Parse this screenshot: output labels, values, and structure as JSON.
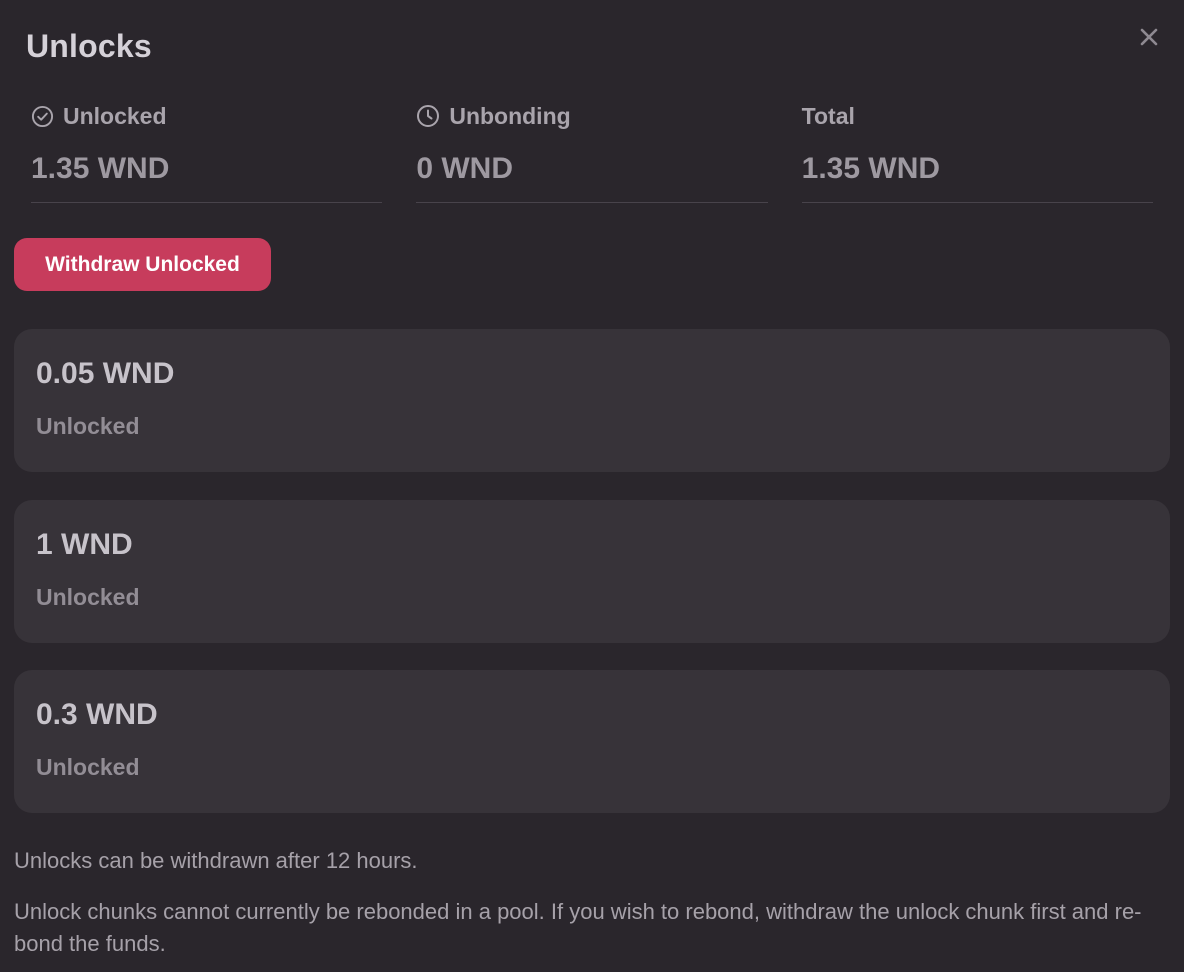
{
  "modal": {
    "title": "Unlocks",
    "close_icon": "close-icon"
  },
  "stats": [
    {
      "label": "Unlocked",
      "value": "1.35 WND",
      "icon": "check-circle-icon"
    },
    {
      "label": "Unbonding",
      "value": "0 WND",
      "icon": "clock-icon"
    },
    {
      "label": "Total",
      "value": "1.35 WND"
    }
  ],
  "actions": {
    "withdraw_label": "Withdraw Unlocked"
  },
  "chunks": [
    {
      "amount": "0.05 WND",
      "status": "Unlocked"
    },
    {
      "amount": "1 WND",
      "status": "Unlocked"
    },
    {
      "amount": "0.3 WND",
      "status": "Unlocked"
    }
  ],
  "notes": [
    "Unlocks can be withdrawn after 12 hours.",
    "Unlock chunks cannot currently be rebonded in a pool. If you wish to rebond, withdraw the unlock chunk first and re-bond the funds."
  ],
  "colors": {
    "background": "#2a262c",
    "card": "#373339",
    "accent": "#c73c5c"
  }
}
